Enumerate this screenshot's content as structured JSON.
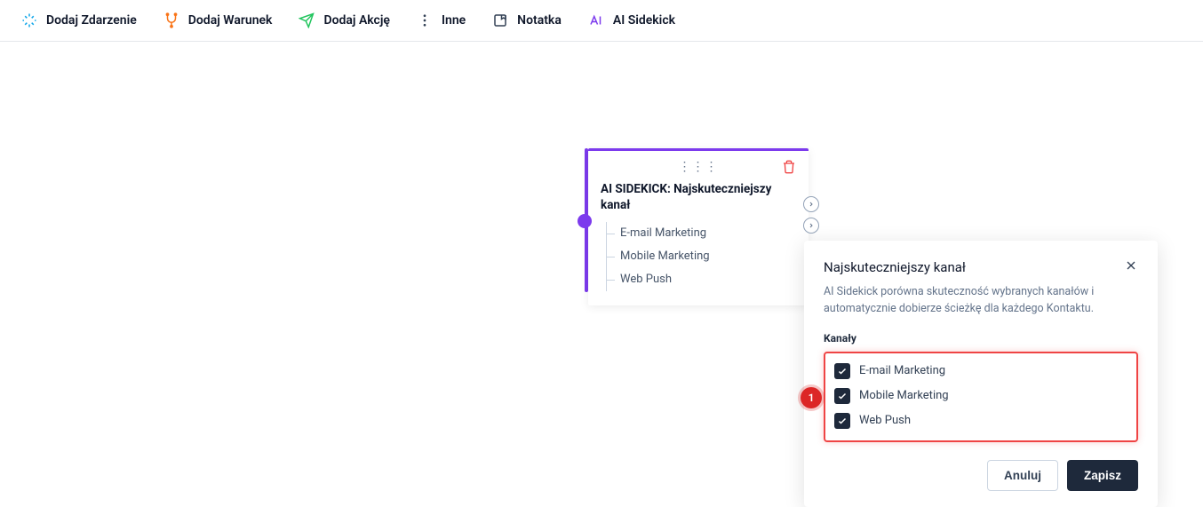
{
  "toolbar": {
    "add_event": "Dodaj Zdarzenie",
    "add_condition": "Dodaj Warunek",
    "add_action": "Dodaj Akcję",
    "other": "Inne",
    "note": "Notatka",
    "ai_sidekick": "AI Sidekick"
  },
  "node": {
    "title": "AI SIDEKICK: Najskuteczniejszy kanał",
    "items": [
      "E-mail Marketing",
      "Mobile Marketing",
      "Web Push"
    ]
  },
  "popup": {
    "title": "Najskuteczniejszy kanał",
    "description": "AI Sidekick porówna skuteczność wybranych kanałów i automatycznie dobierze ścieżkę dla każdego Kontaktu.",
    "section_label": "Kanały",
    "channels": [
      "E-mail Marketing",
      "Mobile Marketing",
      "Web Push"
    ],
    "badge": "1",
    "cancel": "Anuluj",
    "save": "Zapisz"
  },
  "colors": {
    "accent": "#7c3aed",
    "danger": "#ef4444",
    "dark": "#1e293b"
  }
}
